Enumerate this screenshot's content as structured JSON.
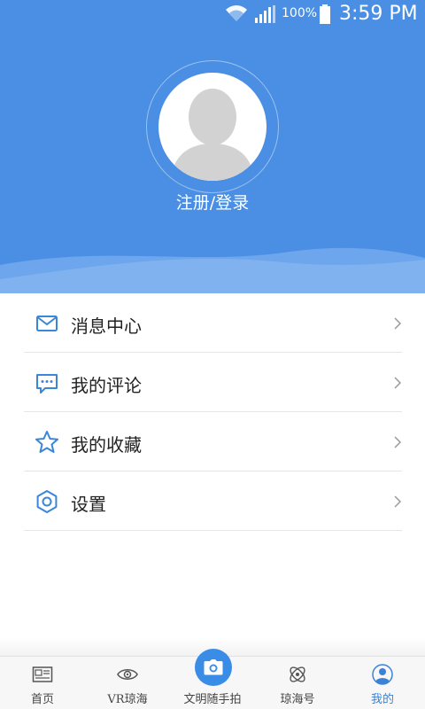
{
  "status_bar": {
    "battery_pct": "100%",
    "time": "3:59 PM",
    "icons": [
      "wifi-icon",
      "signal-icon",
      "battery-icon"
    ]
  },
  "profile": {
    "login_label": "注册/登录"
  },
  "menu": [
    {
      "label": "消息中心",
      "icon": "mail-icon"
    },
    {
      "label": "我的评论",
      "icon": "comment-icon"
    },
    {
      "label": "我的收藏",
      "icon": "star-icon"
    },
    {
      "label": "设置",
      "icon": "settings-icon"
    }
  ],
  "bottom_nav": [
    {
      "label": "首页",
      "icon": "news-icon"
    },
    {
      "label": "VR琼海",
      "icon": "eye-icon"
    },
    {
      "label": "文明随手拍",
      "icon": "camera-icon"
    },
    {
      "label": "琼海号",
      "icon": "atom-icon"
    },
    {
      "label": "我的",
      "icon": "user-icon",
      "active": true
    }
  ],
  "colors": {
    "header_bg": "#4a8fe3",
    "accent": "#3b82d6",
    "icon_blue": "#3a86d8"
  }
}
